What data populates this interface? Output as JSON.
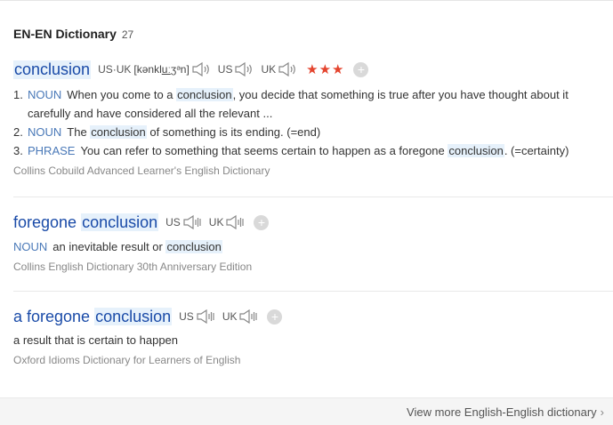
{
  "header": {
    "title": "EN-EN Dictionary",
    "count": "27"
  },
  "entry1": {
    "word": "conclusion",
    "usuk_label": "US·UK",
    "phonetic_pre": "[kənkl",
    "phonetic_u": "uː",
    "phonetic_post": "ʒᵊn]",
    "us_label": "US",
    "uk_label": "UK",
    "stars": "★★★",
    "defs": [
      {
        "num": "1.",
        "pos": "NOUN",
        "pre": "When you come to a ",
        "hl": "conclusion",
        "post": ", you decide that something is true after you have thought about it carefully and have considered all the relevant ..."
      },
      {
        "num": "2.",
        "pos": "NOUN",
        "pre": "The ",
        "hl": "conclusion",
        "post": " of something is its ending. (=end)"
      },
      {
        "num": "3.",
        "pos": "PHRASE",
        "pre": "You can refer to something that seems certain to happen as a foregone ",
        "hl": "conclusion",
        "post": ". (=certainty)"
      }
    ],
    "source": "Collins Cobuild Advanced Learner's English Dictionary"
  },
  "entry2": {
    "word_pre": "foregone ",
    "word_hl": "conclusion",
    "us_label": "US",
    "uk_label": "UK",
    "pos": "NOUN",
    "def_pre": "an inevitable result or ",
    "def_hl": "conclusion",
    "source": "Collins English Dictionary 30th Anniversary Edition"
  },
  "entry3": {
    "word_pre": "a foregone ",
    "word_hl": "conclusion",
    "us_label": "US",
    "uk_label": "UK",
    "def": "a result that is certain to happen",
    "source": "Oxford Idioms Dictionary for Learners of English"
  },
  "footer": {
    "link": "View more English-English dictionary",
    "chevron": "›"
  },
  "icons": {
    "speaker": "speaker-icon",
    "plus": "plus-icon",
    "chevron": "chevron-right-icon"
  },
  "colors": {
    "link_blue": "#1a4ba8",
    "pos_blue": "#4a79b8",
    "highlight": "#e6f1fb",
    "star_red": "#e4442e"
  }
}
